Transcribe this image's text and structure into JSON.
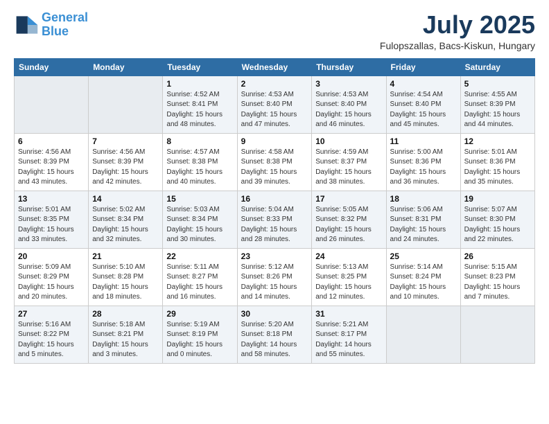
{
  "header": {
    "logo_line1": "General",
    "logo_line2": "Blue",
    "month": "July 2025",
    "location": "Fulopszallas, Bacs-Kiskun, Hungary"
  },
  "weekdays": [
    "Sunday",
    "Monday",
    "Tuesday",
    "Wednesday",
    "Thursday",
    "Friday",
    "Saturday"
  ],
  "weeks": [
    [
      {
        "day": "",
        "info": ""
      },
      {
        "day": "",
        "info": ""
      },
      {
        "day": "1",
        "info": "Sunrise: 4:52 AM\nSunset: 8:41 PM\nDaylight: 15 hours\nand 48 minutes."
      },
      {
        "day": "2",
        "info": "Sunrise: 4:53 AM\nSunset: 8:40 PM\nDaylight: 15 hours\nand 47 minutes."
      },
      {
        "day": "3",
        "info": "Sunrise: 4:53 AM\nSunset: 8:40 PM\nDaylight: 15 hours\nand 46 minutes."
      },
      {
        "day": "4",
        "info": "Sunrise: 4:54 AM\nSunset: 8:40 PM\nDaylight: 15 hours\nand 45 minutes."
      },
      {
        "day": "5",
        "info": "Sunrise: 4:55 AM\nSunset: 8:39 PM\nDaylight: 15 hours\nand 44 minutes."
      }
    ],
    [
      {
        "day": "6",
        "info": "Sunrise: 4:56 AM\nSunset: 8:39 PM\nDaylight: 15 hours\nand 43 minutes."
      },
      {
        "day": "7",
        "info": "Sunrise: 4:56 AM\nSunset: 8:39 PM\nDaylight: 15 hours\nand 42 minutes."
      },
      {
        "day": "8",
        "info": "Sunrise: 4:57 AM\nSunset: 8:38 PM\nDaylight: 15 hours\nand 40 minutes."
      },
      {
        "day": "9",
        "info": "Sunrise: 4:58 AM\nSunset: 8:38 PM\nDaylight: 15 hours\nand 39 minutes."
      },
      {
        "day": "10",
        "info": "Sunrise: 4:59 AM\nSunset: 8:37 PM\nDaylight: 15 hours\nand 38 minutes."
      },
      {
        "day": "11",
        "info": "Sunrise: 5:00 AM\nSunset: 8:36 PM\nDaylight: 15 hours\nand 36 minutes."
      },
      {
        "day": "12",
        "info": "Sunrise: 5:01 AM\nSunset: 8:36 PM\nDaylight: 15 hours\nand 35 minutes."
      }
    ],
    [
      {
        "day": "13",
        "info": "Sunrise: 5:01 AM\nSunset: 8:35 PM\nDaylight: 15 hours\nand 33 minutes."
      },
      {
        "day": "14",
        "info": "Sunrise: 5:02 AM\nSunset: 8:34 PM\nDaylight: 15 hours\nand 32 minutes."
      },
      {
        "day": "15",
        "info": "Sunrise: 5:03 AM\nSunset: 8:34 PM\nDaylight: 15 hours\nand 30 minutes."
      },
      {
        "day": "16",
        "info": "Sunrise: 5:04 AM\nSunset: 8:33 PM\nDaylight: 15 hours\nand 28 minutes."
      },
      {
        "day": "17",
        "info": "Sunrise: 5:05 AM\nSunset: 8:32 PM\nDaylight: 15 hours\nand 26 minutes."
      },
      {
        "day": "18",
        "info": "Sunrise: 5:06 AM\nSunset: 8:31 PM\nDaylight: 15 hours\nand 24 minutes."
      },
      {
        "day": "19",
        "info": "Sunrise: 5:07 AM\nSunset: 8:30 PM\nDaylight: 15 hours\nand 22 minutes."
      }
    ],
    [
      {
        "day": "20",
        "info": "Sunrise: 5:09 AM\nSunset: 8:29 PM\nDaylight: 15 hours\nand 20 minutes."
      },
      {
        "day": "21",
        "info": "Sunrise: 5:10 AM\nSunset: 8:28 PM\nDaylight: 15 hours\nand 18 minutes."
      },
      {
        "day": "22",
        "info": "Sunrise: 5:11 AM\nSunset: 8:27 PM\nDaylight: 15 hours\nand 16 minutes."
      },
      {
        "day": "23",
        "info": "Sunrise: 5:12 AM\nSunset: 8:26 PM\nDaylight: 15 hours\nand 14 minutes."
      },
      {
        "day": "24",
        "info": "Sunrise: 5:13 AM\nSunset: 8:25 PM\nDaylight: 15 hours\nand 12 minutes."
      },
      {
        "day": "25",
        "info": "Sunrise: 5:14 AM\nSunset: 8:24 PM\nDaylight: 15 hours\nand 10 minutes."
      },
      {
        "day": "26",
        "info": "Sunrise: 5:15 AM\nSunset: 8:23 PM\nDaylight: 15 hours\nand 7 minutes."
      }
    ],
    [
      {
        "day": "27",
        "info": "Sunrise: 5:16 AM\nSunset: 8:22 PM\nDaylight: 15 hours\nand 5 minutes."
      },
      {
        "day": "28",
        "info": "Sunrise: 5:18 AM\nSunset: 8:21 PM\nDaylight: 15 hours\nand 3 minutes."
      },
      {
        "day": "29",
        "info": "Sunrise: 5:19 AM\nSunset: 8:19 PM\nDaylight: 15 hours\nand 0 minutes."
      },
      {
        "day": "30",
        "info": "Sunrise: 5:20 AM\nSunset: 8:18 PM\nDaylight: 14 hours\nand 58 minutes."
      },
      {
        "day": "31",
        "info": "Sunrise: 5:21 AM\nSunset: 8:17 PM\nDaylight: 14 hours\nand 55 minutes."
      },
      {
        "day": "",
        "info": ""
      },
      {
        "day": "",
        "info": ""
      }
    ]
  ]
}
